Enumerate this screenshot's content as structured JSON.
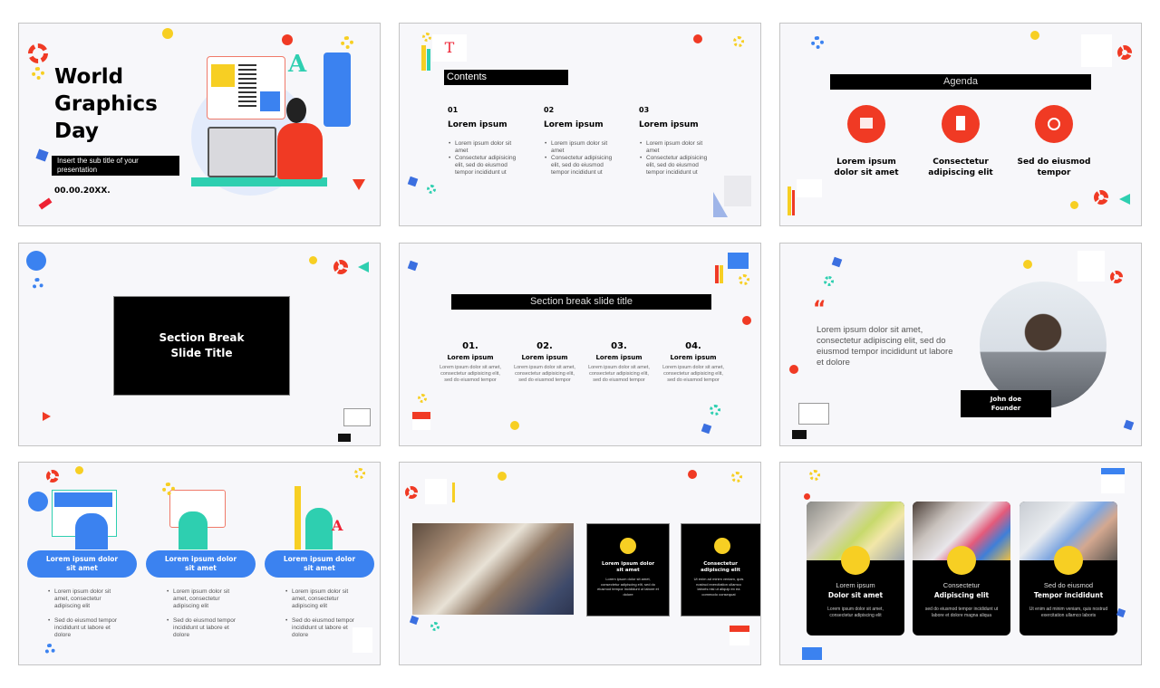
{
  "slides": [
    {
      "title_lines": [
        "World",
        "Graphics",
        "Day"
      ],
      "subtitle": "Insert the sub title of your presentation",
      "date": "00.00.20XX."
    },
    {
      "heading": "Contents",
      "columns": [
        {
          "number": "01",
          "title": "Lorem ipsum",
          "bullets": [
            "Lorem ipsum dolor sit amet",
            "Consectetur adipisicing elit, sed do eiusmod tempor incididunt ut"
          ]
        },
        {
          "number": "02",
          "title": "Lorem ipsum",
          "bullets": [
            "Lorem ipsum dolor sit amet",
            "Consectetur adipisicing elit, sed do eiusmod tempor incididunt ut"
          ]
        },
        {
          "number": "03",
          "title": "Lorem ipsum",
          "bullets": [
            "Lorem ipsum dolor sit amet",
            "Consectetur adipisicing elit, sed do eiusmod tempor incididunt ut"
          ]
        }
      ]
    },
    {
      "heading": "Agenda",
      "items": [
        {
          "icon": "calendar-icon",
          "label": "Lorem ipsum dolor sit amet"
        },
        {
          "icon": "document-icon",
          "label": "Consectetur adipiscing elit"
        },
        {
          "icon": "target-icon",
          "label": "Sed do eiusmod tempor"
        }
      ]
    },
    {
      "title_lines": [
        "Section Break",
        "Slide Title"
      ]
    },
    {
      "heading": "Section break slide title",
      "columns": [
        {
          "number": "01.",
          "title": "Lorem ipsum",
          "text": "Lorem ipsum dolor sit amet, consectetur adipisicing elit, sed do eiusmod tempor"
        },
        {
          "number": "02.",
          "title": "Lorem ipsum",
          "text": "Lorem ipsum dolor sit amet, consectetur adipisicing elit, sed do eiusmod tempor"
        },
        {
          "number": "03.",
          "title": "Lorem ipsum",
          "text": "Lorem ipsum dolor sit amet, consectetur adipisicing elit, sed do eiusmod tempor"
        },
        {
          "number": "04.",
          "title": "Lorem ipsum",
          "text": "Lorem ipsum dolor sit amet, consectetur adipisicing elit, sed do eiusmod tempor"
        }
      ]
    },
    {
      "quote_mark": "“",
      "quote": "Lorem ipsum dolor sit amet, consectetur adipiscing elit, sed do eiusmod tempor incididunt ut labore et dolore",
      "name": "John doe",
      "role": "Founder"
    },
    {
      "cards": [
        {
          "title": "Lorem ipsum dolor sit amet",
          "bullets": [
            "Lorem ipsum dolor sit amet, consectetur adipiscing elit",
            "Sed do eiusmod tempor incididunt ut labore et dolore"
          ]
        },
        {
          "title": "Lorem ipsum dolor sit amet",
          "bullets": [
            "Lorem ipsum dolor sit amet, consectetur adipiscing elit",
            "Sed do eiusmod tempor incididunt ut labore et dolore"
          ]
        },
        {
          "title": "Lorem ipsum dolor sit amet",
          "bullets": [
            "Lorem ipsum dolor sit amet, consectetur adipiscing elit",
            "Sed do eiusmod tempor incididunt ut labore et dolore"
          ]
        }
      ]
    },
    {
      "cards": [
        {
          "icon": "team-idea-icon",
          "title": "Lorem ipsum dolor sit amet",
          "text": "Lorem ipsum dolor sit amet, consectetur adipiscing elit, sed do eiusmod tempor incididunt ut labore et dolore"
        },
        {
          "icon": "globe-icon",
          "title": "Consectetur adipiscing elit",
          "text": "Ut enim ad minim veniam, quis nostrud exercitation ullamco laboris nisi ut aliquip ex ea commodo consequat"
        }
      ]
    },
    {
      "cards": [
        {
          "icon": "lightbulb-icon",
          "title_light": "Lorem ipsum",
          "title_bold": "Dolor sit amet",
          "text": "Lorem ipsum dolor sit amet, consectetur adipiscing elit"
        },
        {
          "icon": "palette-icon",
          "title_light": "Consectetur",
          "title_bold": "Adipiscing elit",
          "text": "sed do eiusmod tempor incididunt ut labore et dolore magna aliqua"
        },
        {
          "icon": "rocket-icon",
          "title_light": "Sed do eiusmod",
          "title_bold": "Tempor incididunt",
          "text": "Ut enim ad minim veniam, quis nostrud exercitation ullamco laboris"
        }
      ]
    }
  ],
  "colors": {
    "accent_red": "#f03a24",
    "accent_blue": "#3b82f0",
    "accent_yellow": "#f7cf23",
    "accent_teal": "#2ecfb0",
    "slide_bg": "#f7f7fa"
  }
}
